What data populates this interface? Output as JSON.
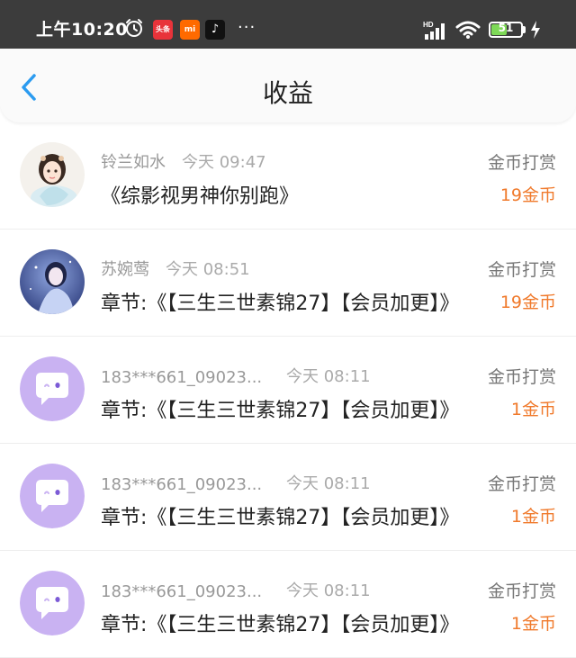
{
  "status_bar": {
    "time": "上午10:20",
    "badges": {
      "toutiao": "头条",
      "mi": "mi",
      "tiktok": "♪"
    },
    "more": "···",
    "battery": "51",
    "icons": [
      "alarm-icon",
      "signal-icon",
      "wifi-icon",
      "battery-icon",
      "charging-icon"
    ]
  },
  "header": {
    "title": "收益",
    "back_icon": "chevron-left-icon",
    "accent_color": "#2b9bf0"
  },
  "items": [
    {
      "name": "铃兰如水",
      "time": "今天 09:47",
      "title": "《综影视男神你别跑》",
      "type": "金币打赏",
      "amount": "19金币",
      "avatar": "photo"
    },
    {
      "name": "苏婉莺",
      "time": "今天 08:51",
      "title": "章节:《【三生三世素锦27】【会员加更】》",
      "type": "金币打赏",
      "amount": "19金币",
      "avatar": "photo"
    },
    {
      "name": "183***661_09023...",
      "time": "今天 08:11",
      "title": "章节:《【三生三世素锦27】【会员加更】》",
      "type": "金币打赏",
      "amount": "1金币",
      "avatar": "default"
    },
    {
      "name": "183***661_09023...",
      "time": "今天 08:11",
      "title": "章节:《【三生三世素锦27】【会员加更】》",
      "type": "金币打赏",
      "amount": "1金币",
      "avatar": "default"
    },
    {
      "name": "183***661_09023...",
      "time": "今天 08:11",
      "title": "章节:《【三生三世素锦27】【会员加更】》",
      "type": "金币打赏",
      "amount": "1金币",
      "avatar": "default"
    }
  ],
  "colors": {
    "amount": "#f07a2c",
    "default_avatar": "#c9b2f2",
    "status_bar": "#3c3c3c"
  }
}
